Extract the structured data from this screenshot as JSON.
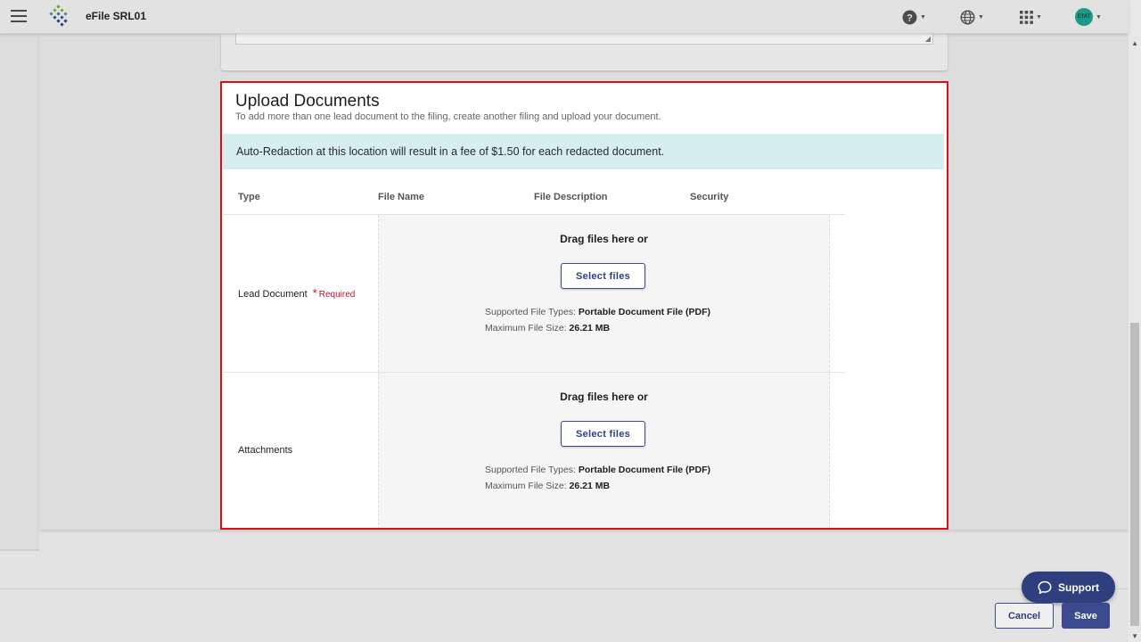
{
  "header": {
    "app_title": "eFile SRL01",
    "avatar_initials": "ETAT"
  },
  "upload": {
    "title": "Upload Documents",
    "subtitle": "To add more than one lead document to the filing, create another filing and upload your document.",
    "notice": "Auto-Redaction at this location will result in a fee of $1.50 for each redacted document.",
    "columns": [
      "Type",
      "File Name",
      "File Description",
      "Security"
    ],
    "rows": [
      {
        "type": "Lead Document",
        "required_mark": "*",
        "required_label": "Required",
        "drag_text": "Drag files here or",
        "select_label": "Select files",
        "types_label": "Supported File Types:",
        "types_value": "Portable Document File (PDF)",
        "size_label": "Maximum File Size:",
        "size_value": "26.21 MB"
      },
      {
        "type": "Attachments",
        "drag_text": "Drag files here or",
        "select_label": "Select files",
        "types_label": "Supported File Types:",
        "types_value": "Portable Document File (PDF)",
        "size_label": "Maximum File Size:",
        "size_value": "26.21 MB"
      }
    ]
  },
  "footer": {
    "support_label": "Support",
    "cancel_label": "Cancel",
    "save_label": "Save"
  },
  "colors": {
    "primary": "#2f3f7d",
    "highlight_border": "#d8101a",
    "notice_bg": "#d7eef1",
    "required": "#c8102e"
  },
  "icons": [
    "menu-icon",
    "logo-icon",
    "help-icon",
    "globe-icon",
    "apps-grid-icon",
    "chat-bubble-icon",
    "resize-grip-icon"
  ]
}
